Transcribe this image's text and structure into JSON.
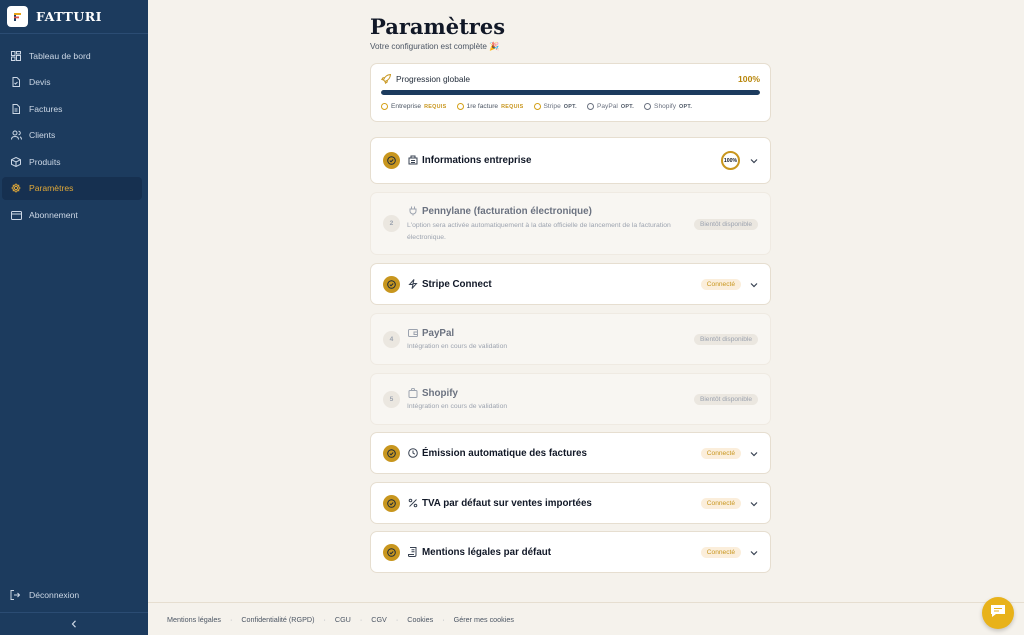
{
  "brand": {
    "name": "FATTURI"
  },
  "sidebar": {
    "items": [
      {
        "label": "Tableau de bord",
        "icon": "dashboard-icon"
      },
      {
        "label": "Devis",
        "icon": "quote-icon"
      },
      {
        "label": "Factures",
        "icon": "invoice-icon"
      },
      {
        "label": "Clients",
        "icon": "users-icon"
      },
      {
        "label": "Produits",
        "icon": "box-icon"
      },
      {
        "label": "Paramètres",
        "icon": "gear-icon",
        "active": true
      },
      {
        "label": "Abonnement",
        "icon": "card-icon"
      }
    ],
    "logout_label": "Déconnexion"
  },
  "page": {
    "title": "Paramètres",
    "subtitle": "Votre configuration est complète 🎉"
  },
  "progress": {
    "label": "Progression globale",
    "percent_label": "100%",
    "value": 100,
    "steps": [
      {
        "label": "Entreprise",
        "tag": "REQUIS",
        "done": true
      },
      {
        "label": "1re facture",
        "tag": "REQUIS",
        "done": true
      },
      {
        "label": "Stripe",
        "tag": "OPT.",
        "done": true
      },
      {
        "label": "PayPal",
        "tag": "OPT.",
        "done": false
      },
      {
        "label": "Shopify",
        "tag": "OPT.",
        "done": false
      }
    ]
  },
  "sections": {
    "entreprise": {
      "title": "Informations entreprise",
      "ring": "100%"
    },
    "pennylane": {
      "number": "2",
      "title": "Pennylane (facturation électronique)",
      "desc": "L'option sera activée automatiquement à la date officielle de lancement de la facturation électronique.",
      "status": "Bientôt disponible"
    },
    "stripe": {
      "title": "Stripe Connect",
      "status": "Connecté"
    },
    "paypal": {
      "number": "4",
      "title": "PayPal",
      "desc": "Intégration en cours de validation",
      "status": "Bientôt disponible"
    },
    "shopify": {
      "number": "5",
      "title": "Shopify",
      "desc": "Intégration en cours de validation",
      "status": "Bientôt disponible"
    },
    "emission": {
      "title": "Émission automatique des factures",
      "status": "Connecté"
    },
    "tva": {
      "title": "TVA par défaut sur ventes importées",
      "status": "Connecté"
    },
    "mentions": {
      "title": "Mentions légales par défaut",
      "status": "Connecté"
    }
  },
  "footer": {
    "links": [
      "Mentions légales",
      "Confidentialité (RGPD)",
      "CGU",
      "CGV",
      "Cookies",
      "Gérer mes cookies"
    ],
    "separator": "·"
  },
  "colors": {
    "sidebar": "#1c3b5e",
    "accent": "#c8961e",
    "background": "#f5f2ec"
  }
}
